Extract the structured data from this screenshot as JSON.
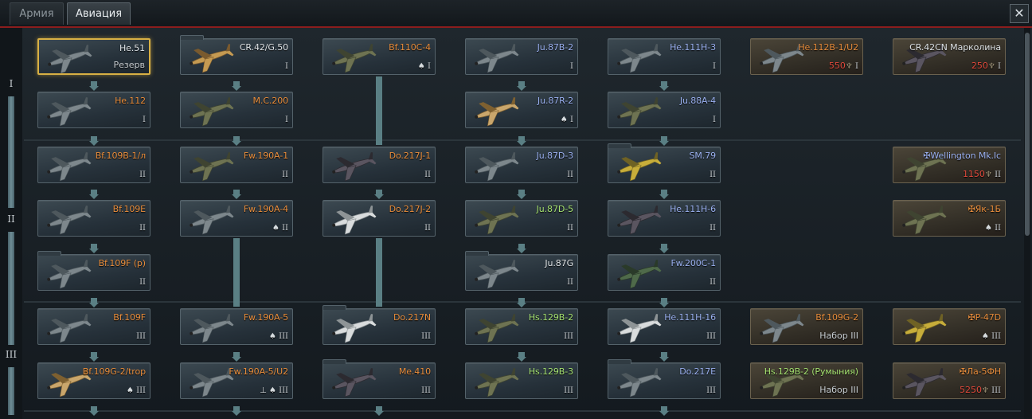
{
  "tabs": [
    {
      "label": "Армия",
      "active": false
    },
    {
      "label": "Авиация",
      "active": true
    }
  ],
  "close_icon": "close-icon",
  "rank_labels": [
    "I",
    "II",
    "III"
  ],
  "colors": {
    "accent_red": "#8c1d1d",
    "selected_border": "#d8b044",
    "price": "#e04a3c",
    "name_orange": "#e88d3c",
    "name_blue": "#9ab0f0",
    "name_green": "#a4e070"
  },
  "cards": [
    {
      "name": "He.51",
      "sub": "Резерв",
      "color": "white",
      "camo": "grey",
      "selected": true
    },
    {
      "name": "He.112",
      "tier": "I",
      "color": "orange",
      "camo": "grey"
    },
    {
      "name": "CR.42/G.50",
      "tier": "I",
      "color": "white",
      "camo": "tan",
      "folder": true
    },
    {
      "name": "M.C.200",
      "tier": "I",
      "color": "orange",
      "camo": "olive"
    },
    {
      "name": "Bf.110C-4",
      "tier": "I",
      "club": true,
      "color": "orange",
      "camo": "olive"
    },
    {
      "name": "Ju.87B-2",
      "tier": "I",
      "color": "blue",
      "camo": "grey"
    },
    {
      "name": "Ju.87R-2",
      "tier": "I",
      "club": true,
      "color": "blue",
      "camo": "desert"
    },
    {
      "name": "He.111H-3",
      "tier": "I",
      "color": "blue",
      "camo": "grey"
    },
    {
      "name": "Ju.88A-4",
      "tier": "I",
      "color": "blue",
      "camo": "olive"
    },
    {
      "name": "He.112B-1/U2",
      "price": "550",
      "tier": "I",
      "color": "orange",
      "camo": "grey",
      "premium": true
    },
    {
      "name": "CR.42CN Марколина",
      "price": "250",
      "tier": "I",
      "color": "white",
      "camo": "dark",
      "premium": true
    },
    {
      "name": "Bf.109B-1/л",
      "tier": "II",
      "color": "orange",
      "camo": "grey"
    },
    {
      "name": "Bf.109E",
      "tier": "II",
      "color": "orange",
      "camo": "grey"
    },
    {
      "name": "Bf.109F (р)",
      "tier": "II",
      "color": "orange",
      "camo": "grey",
      "folder": true
    },
    {
      "name": "Fw.190A-1",
      "tier": "II",
      "color": "orange",
      "camo": "olive"
    },
    {
      "name": "Fw.190A-4",
      "tier": "II",
      "club": true,
      "color": "orange",
      "camo": "grey"
    },
    {
      "name": "Do.217J-1",
      "tier": "II",
      "color": "orange",
      "camo": "dark"
    },
    {
      "name": "Do.217J-2",
      "tier": "II",
      "color": "orange",
      "camo": "white"
    },
    {
      "name": "Ju.87D-3",
      "tier": "II",
      "color": "blue",
      "camo": "grey"
    },
    {
      "name": "Ju.87D-5",
      "tier": "II",
      "color": "green",
      "camo": "olive"
    },
    {
      "name": "Ju.87G",
      "tier": "II",
      "color": "white",
      "camo": "grey",
      "folder": true
    },
    {
      "name": "SM.79",
      "tier": "II",
      "color": "blue",
      "camo": "yellow",
      "folder": true
    },
    {
      "name": "He.111H-6",
      "tier": "II",
      "color": "blue",
      "camo": "dark"
    },
    {
      "name": "Fw.200C-1",
      "tier": "II",
      "color": "blue",
      "camo": "green"
    },
    {
      "name": "Wellington Mk.Ic",
      "price": "1150",
      "tier": "II",
      "color": "blue",
      "camo": "olive",
      "premium": true,
      "mark": "✠"
    },
    {
      "name": "Як-1Б",
      "tier": "II",
      "club": true,
      "color": "orange",
      "camo": "olive",
      "premium": true,
      "mark": "✠"
    },
    {
      "name": "Bf.109F",
      "tier": "III",
      "color": "orange",
      "camo": "grey"
    },
    {
      "name": "Bf.109G-2/trop",
      "tier": "III",
      "club": true,
      "color": "orange",
      "camo": "desert"
    },
    {
      "name": "Fw.190A-5",
      "tier": "III",
      "club": true,
      "color": "orange",
      "camo": "grey"
    },
    {
      "name": "Fw.190A-5/U2",
      "tier": "III",
      "club": true,
      "bomb": true,
      "color": "orange",
      "camo": "grey"
    },
    {
      "name": "Do.217N",
      "tier": "III",
      "color": "orange",
      "camo": "white",
      "folder": true
    },
    {
      "name": "Me.410",
      "tier": "III",
      "color": "orange",
      "camo": "dark",
      "folder": true
    },
    {
      "name": "Hs.129B-2",
      "tier": "III",
      "color": "green",
      "camo": "olive"
    },
    {
      "name": "Hs.129B-3",
      "tier": "III",
      "color": "green",
      "camo": "olive"
    },
    {
      "name": "He.111H-16",
      "tier": "III",
      "color": "blue",
      "camo": "white"
    },
    {
      "name": "Do.217E",
      "tier": "III",
      "color": "blue",
      "camo": "grey",
      "folder": true
    },
    {
      "name": "Bf.109G-2",
      "sub": "Набор III",
      "color": "orange",
      "camo": "grey",
      "premium": true
    },
    {
      "name": "Hs.129B-2 (Румыния)",
      "sub": "Набор III",
      "color": "green",
      "camo": "olive",
      "premium": true
    },
    {
      "name": "P-47D",
      "tier": "III",
      "club": true,
      "color": "orange",
      "camo": "yellow",
      "premium": true,
      "mark": "✠"
    },
    {
      "name": "Ла-5ФН",
      "price": "5250",
      "tier": "III",
      "color": "orange",
      "camo": "dark",
      "premium": true,
      "mark": "✠"
    }
  ]
}
